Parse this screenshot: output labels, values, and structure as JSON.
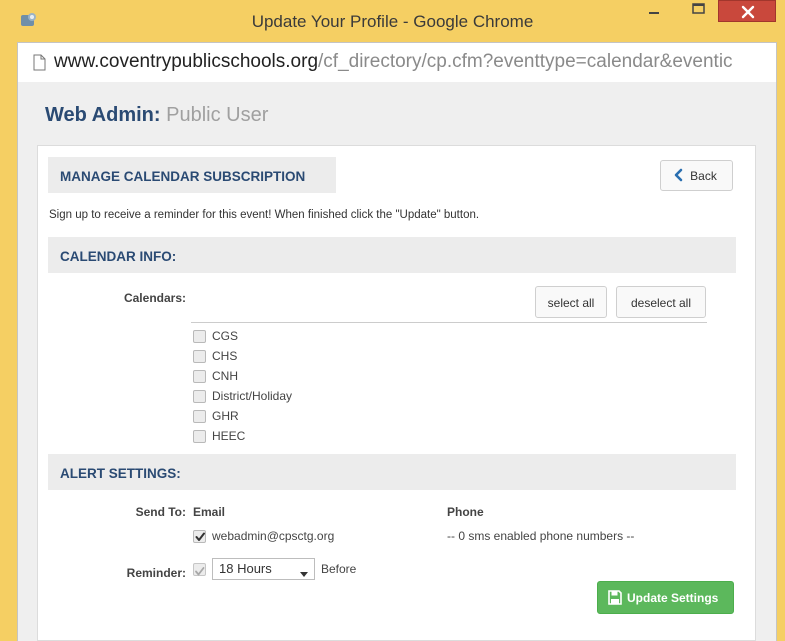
{
  "window": {
    "title": "Update Your Profile - Google Chrome",
    "minimize_glyph": "–",
    "maximize_glyph": "□",
    "close_glyph": "×"
  },
  "address": {
    "host": "www.coventrypublicschools.org",
    "path": "/cf_directory/cp.cfm?eventtype=calendar&eventic"
  },
  "heading": {
    "main": "Web Admin",
    "separator": ":",
    "sub": " Public User"
  },
  "manage": {
    "title": "MANAGE CALENDAR SUBSCRIPTION",
    "back_label": "Back",
    "intro": "Sign up to receive a reminder for this event! When finished click the \"Update\" button."
  },
  "calendar_info": {
    "title": "CALENDAR INFO:",
    "calendars_label": "Calendars:",
    "select_all": "select all",
    "deselect_all": "deselect all",
    "items": [
      {
        "label": "CGS",
        "checked": false
      },
      {
        "label": "CHS",
        "checked": false
      },
      {
        "label": "CNH",
        "checked": false
      },
      {
        "label": "District/Holiday",
        "checked": false
      },
      {
        "label": "GHR",
        "checked": false
      },
      {
        "label": "HEEC",
        "checked": false
      }
    ]
  },
  "alert_settings": {
    "title": "ALERT SETTINGS:",
    "send_to_label": "Send To:",
    "email_header": "Email",
    "phone_header": "Phone",
    "email_value": "webadmin@cpsctg.org",
    "email_checked": true,
    "phone_note": "-- 0 sms enabled phone numbers --",
    "reminder_label": "Reminder:",
    "reminder_checked": true,
    "reminder_value": "18 Hours",
    "before_label": "Before",
    "update_label": "Update Settings"
  },
  "colors": {
    "heading_blue": "#2a4a73",
    "titlebar": "#f5cf63",
    "close_red": "#c9483c",
    "success_green": "#5cb85c"
  },
  "icons": {
    "app": "chrome-app-icon",
    "page": "page-icon",
    "back": "chevron-left-icon",
    "save": "floppy-disk-icon",
    "dropdown": "caret-down-icon",
    "check": "checkmark-icon"
  }
}
